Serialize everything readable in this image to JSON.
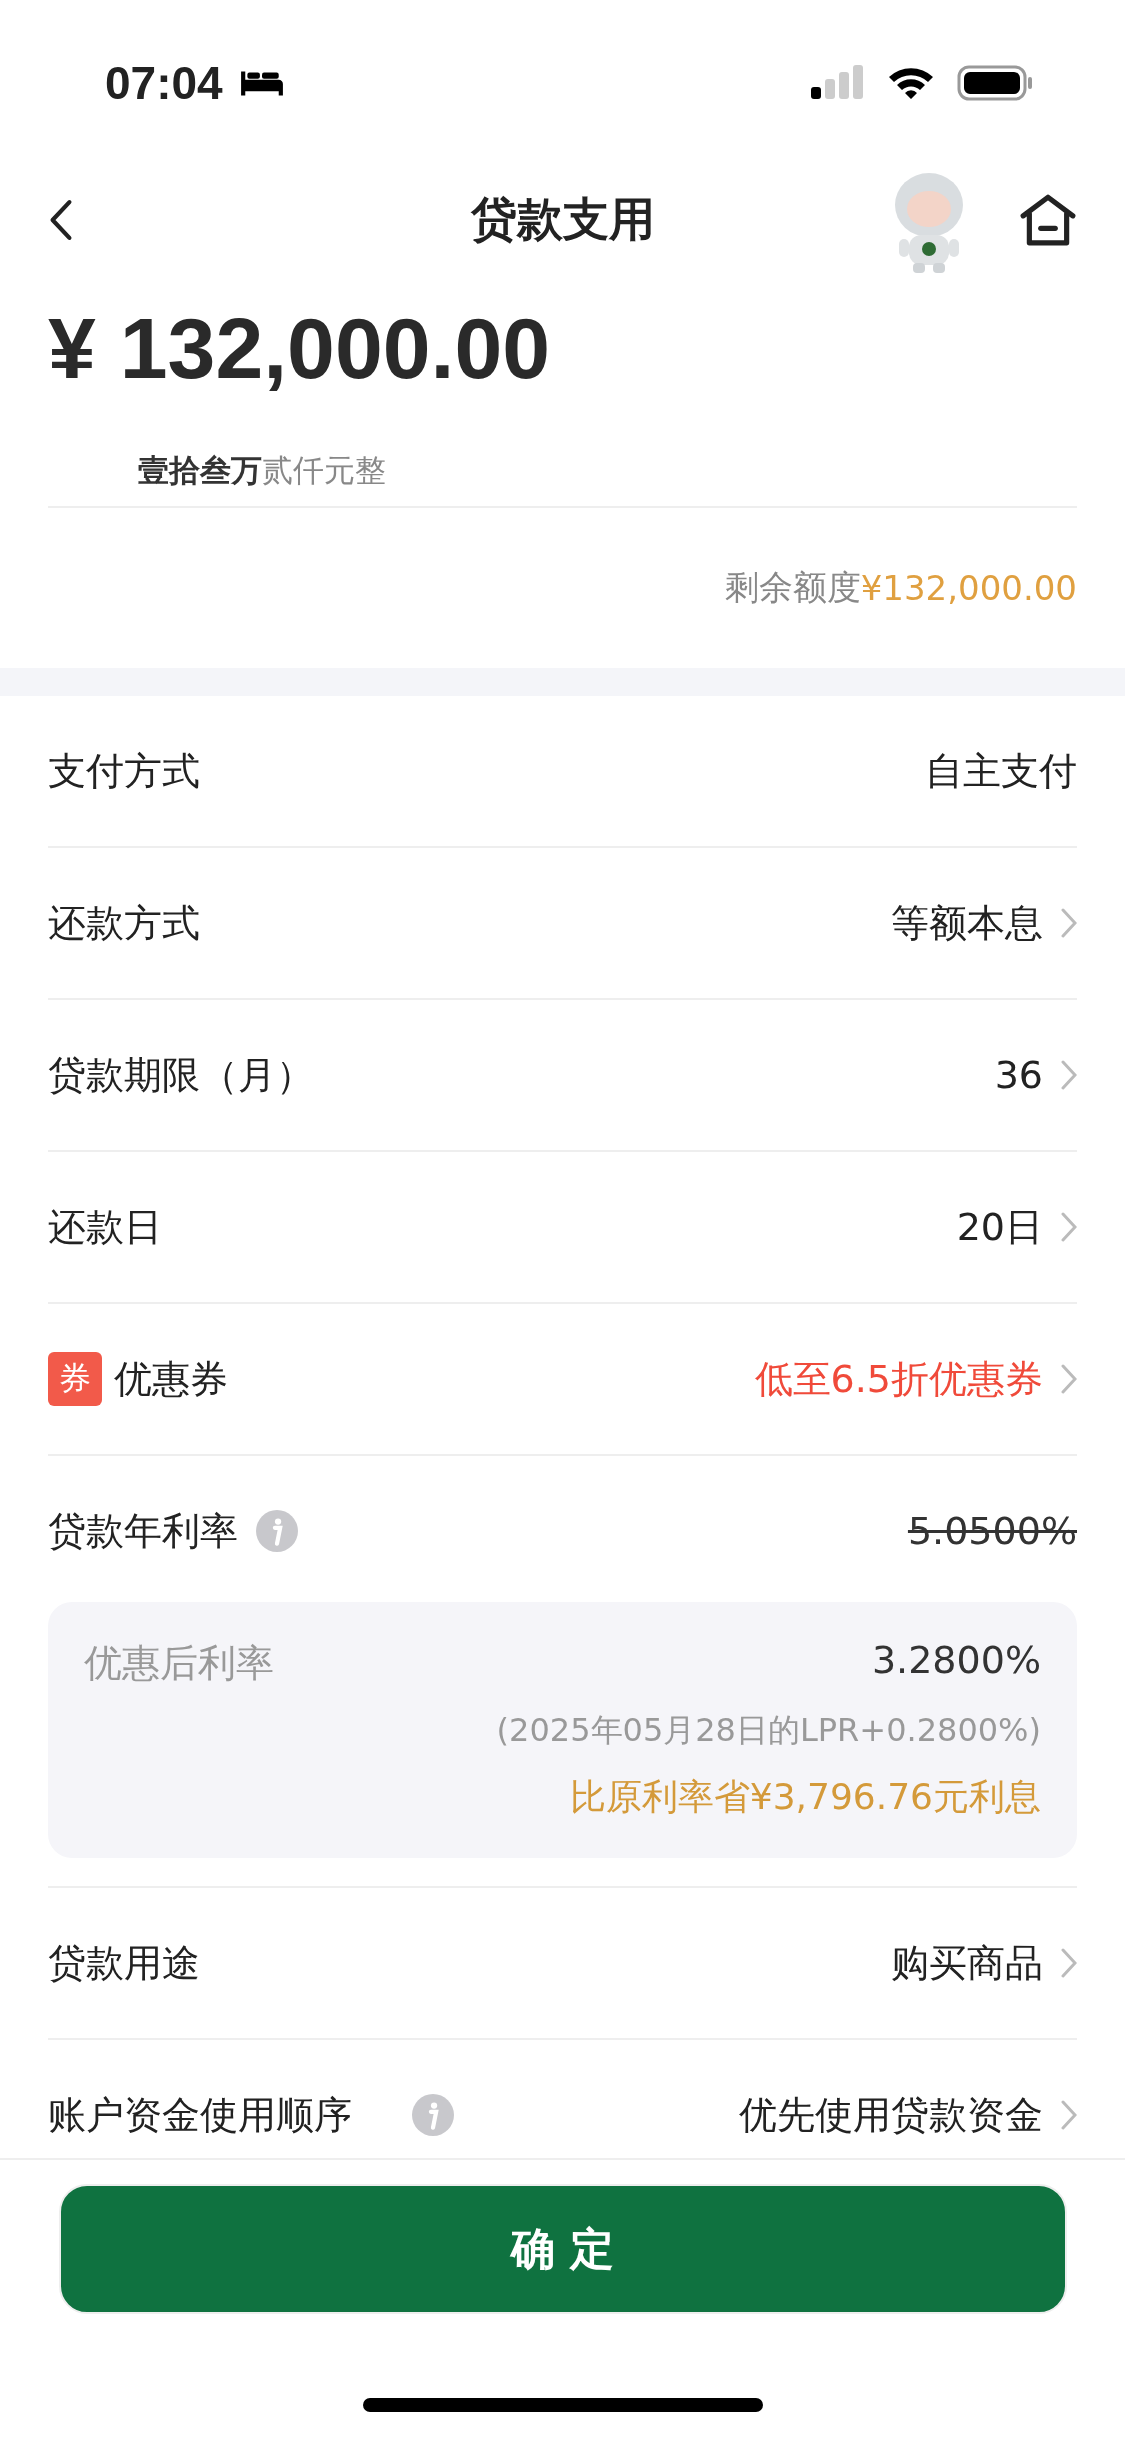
{
  "status_bar": {
    "time": "07:04"
  },
  "header": {
    "title": "贷款支用"
  },
  "amount": {
    "value": "¥ 132,000.00",
    "words": "**壹拾叁万**贰仟元整",
    "remaining_label": "剩余额度",
    "remaining_value": "¥132,000.00"
  },
  "rows": [
    {
      "kind": "plain",
      "label": "支付方式",
      "value": "自主支付",
      "chevron": false,
      "info": false
    },
    {
      "kind": "plain",
      "label": "还款方式",
      "value": "等额本息",
      "chevron": true,
      "info": false
    },
    {
      "kind": "plain",
      "label": "贷款期限（月）",
      "value": "36",
      "chevron": true,
      "info": false
    },
    {
      "kind": "plain",
      "label": "还款日",
      "value": "20日",
      "chevron": true,
      "info": false
    },
    {
      "kind": "coupon",
      "label": "优惠券",
      "badge": "券",
      "value": "低至6.5折优惠券",
      "chevron": true,
      "info": false
    },
    {
      "kind": "struck",
      "label": "贷款年利率",
      "value": "5.0500%",
      "chevron": false,
      "info": true
    }
  ],
  "discount": {
    "label": "优惠后利率",
    "rate": "3.2800%",
    "note": "(2025年05月28日的LPR+0.2800%)",
    "saving": "比原利率省¥3,796.76元利息"
  },
  "more_rows": [
    {
      "kind": "plain",
      "label": "贷款用途",
      "value": "购买商品",
      "chevron": true,
      "info": false
    },
    {
      "kind": "plain",
      "label": "账户资金使用顺序",
      "value": "优先使用贷款资金",
      "chevron": true,
      "info": true
    }
  ],
  "confirm_button": "确 定"
}
